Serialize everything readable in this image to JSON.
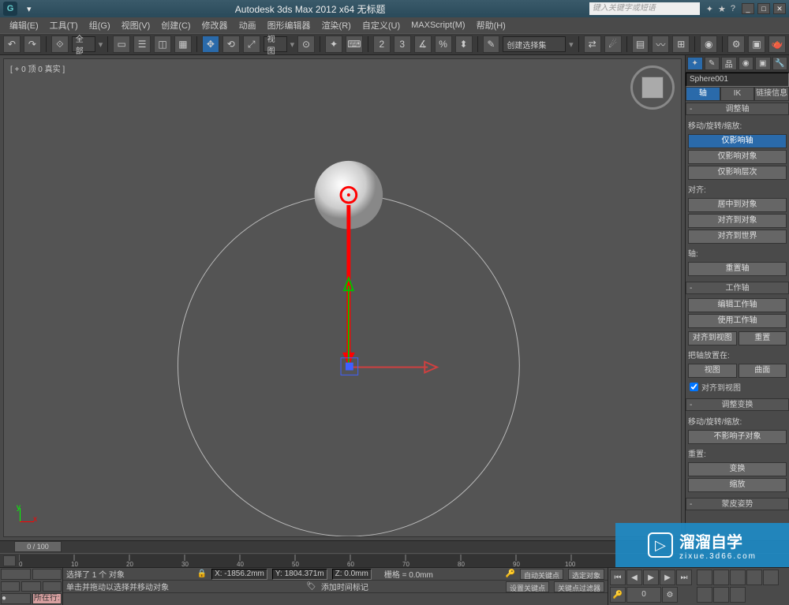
{
  "title_bar": {
    "app_title": "Autodesk 3ds Max 2012 x64   无标题",
    "search_placeholder": "键入关键字或短语"
  },
  "menu": {
    "edit": "编辑(E)",
    "tools": "工具(T)",
    "group": "组(G)",
    "views": "视图(V)",
    "create": "创建(C)",
    "modifiers": "修改器",
    "animation": "动画",
    "graph": "图形编辑器",
    "rendering": "渲染(R)",
    "customize": "自定义(U)",
    "maxscript": "MAXScript(M)",
    "help": "帮助(H)"
  },
  "toolbar": {
    "all_dropdown": "全部",
    "view_dropdown": "视图",
    "select_set": "创建选择集"
  },
  "viewport": {
    "label": "[ + 0 顶 0 真实 ]"
  },
  "cmd_panel": {
    "object_name": "Sphere001",
    "tab_axis": "轴",
    "tab_ik": "IK",
    "tab_link": "链接信息",
    "adjust_pivot": {
      "header": "调整轴",
      "group_label": "移动/旋转/缩放:",
      "affect_pivot": "仅影响轴",
      "affect_object": "仅影响对象",
      "affect_hierarchy": "仅影响层次",
      "align_label": "对齐:",
      "center": "居中到对象",
      "align_obj": "对齐到对象",
      "align_world": "对齐到世界",
      "pivot_label": "轴:",
      "reset_pivot": "重置轴"
    },
    "working_pivot": {
      "header": "工作轴",
      "edit": "编辑工作轴",
      "use": "使用工作轴",
      "align_view": "对齐到视图",
      "reset": "重置",
      "place_label": "把轴放置在:",
      "view_btn": "视图",
      "surface_btn": "曲面",
      "align_chk": "对齐到视图"
    },
    "adjust_xform": {
      "header": "调整变换",
      "group_label": "移动/旋转/缩放:",
      "dont_affect": "不影响子对象",
      "reset_label": "重置:",
      "transform": "变换",
      "scale": "缩放"
    },
    "skin_pose": {
      "header": "蒙皮姿势"
    }
  },
  "time_slider": {
    "frame": "0 / 100"
  },
  "status": {
    "row_label": "所在行:",
    "sel_text": "选择了 1 个 对象",
    "hint": "单击并拖动以选择并移动对象",
    "add_time_tag": "添加时间标记",
    "x": "X: -1856.2mm",
    "y": "Y: 1804.371m",
    "z": "Z: 0.0mm",
    "grid": "栅格 = 0.0mm",
    "auto_key": "自动关键点",
    "set_key": "设置关键点",
    "sel_set": "选定对象",
    "key_filter": "关键点过滤器"
  },
  "watermark": {
    "main": "溜溜自学",
    "sub": "zixue.3d66.com"
  }
}
